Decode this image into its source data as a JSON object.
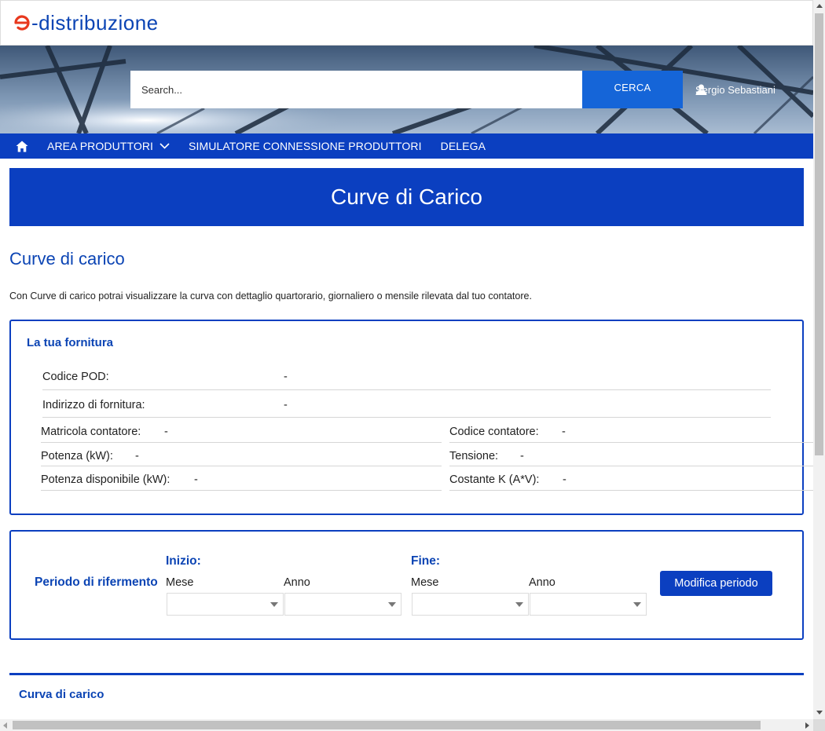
{
  "header": {
    "logo_text": "-distribuzione",
    "brand_color": "#0b44b4",
    "logo_accent": "#e8381e"
  },
  "search": {
    "placeholder": "Search...",
    "button_label": "CERCA"
  },
  "user": {
    "name": "Sergio Sebastiani"
  },
  "nav": {
    "items": [
      {
        "label": "AREA PRODUTTORI"
      },
      {
        "label": "SIMULATORE CONNESSIONE PRODUTTORI"
      },
      {
        "label": "DELEGA"
      }
    ]
  },
  "banner": {
    "title": "Curve di Carico"
  },
  "page": {
    "title": "Curve di carico",
    "intro": "Con Curve di carico potrai visualizzare la curva con dettaglio quartorario, giornaliero o mensile rilevata dal tuo contatore."
  },
  "fornitura": {
    "title": "La tua fornitura",
    "codice_pod": {
      "label": "Codice POD:",
      "value": "-"
    },
    "indirizzo": {
      "label": "Indirizzo di fornitura:",
      "value": "-"
    },
    "matricola": {
      "label": "Matricola contatore:",
      "value": "-"
    },
    "codice_contatore": {
      "label": "Codice contatore:",
      "value": "-"
    },
    "potenza": {
      "label": "Potenza (kW):",
      "value": "-"
    },
    "tensione": {
      "label": "Tensione:",
      "value": "-"
    },
    "potenza_disp": {
      "label": "Potenza disponibile (kW):",
      "value": "-"
    },
    "costante": {
      "label": "Costante K (A*V):",
      "value": "-"
    }
  },
  "periodo": {
    "title": "Periodo di rifermento",
    "inizio": "Inizio:",
    "fine": "Fine:",
    "mese_label": "Mese",
    "anno_label": "Anno",
    "button_label": "Modifica periodo"
  },
  "curva": {
    "title": "Curva di carico"
  }
}
